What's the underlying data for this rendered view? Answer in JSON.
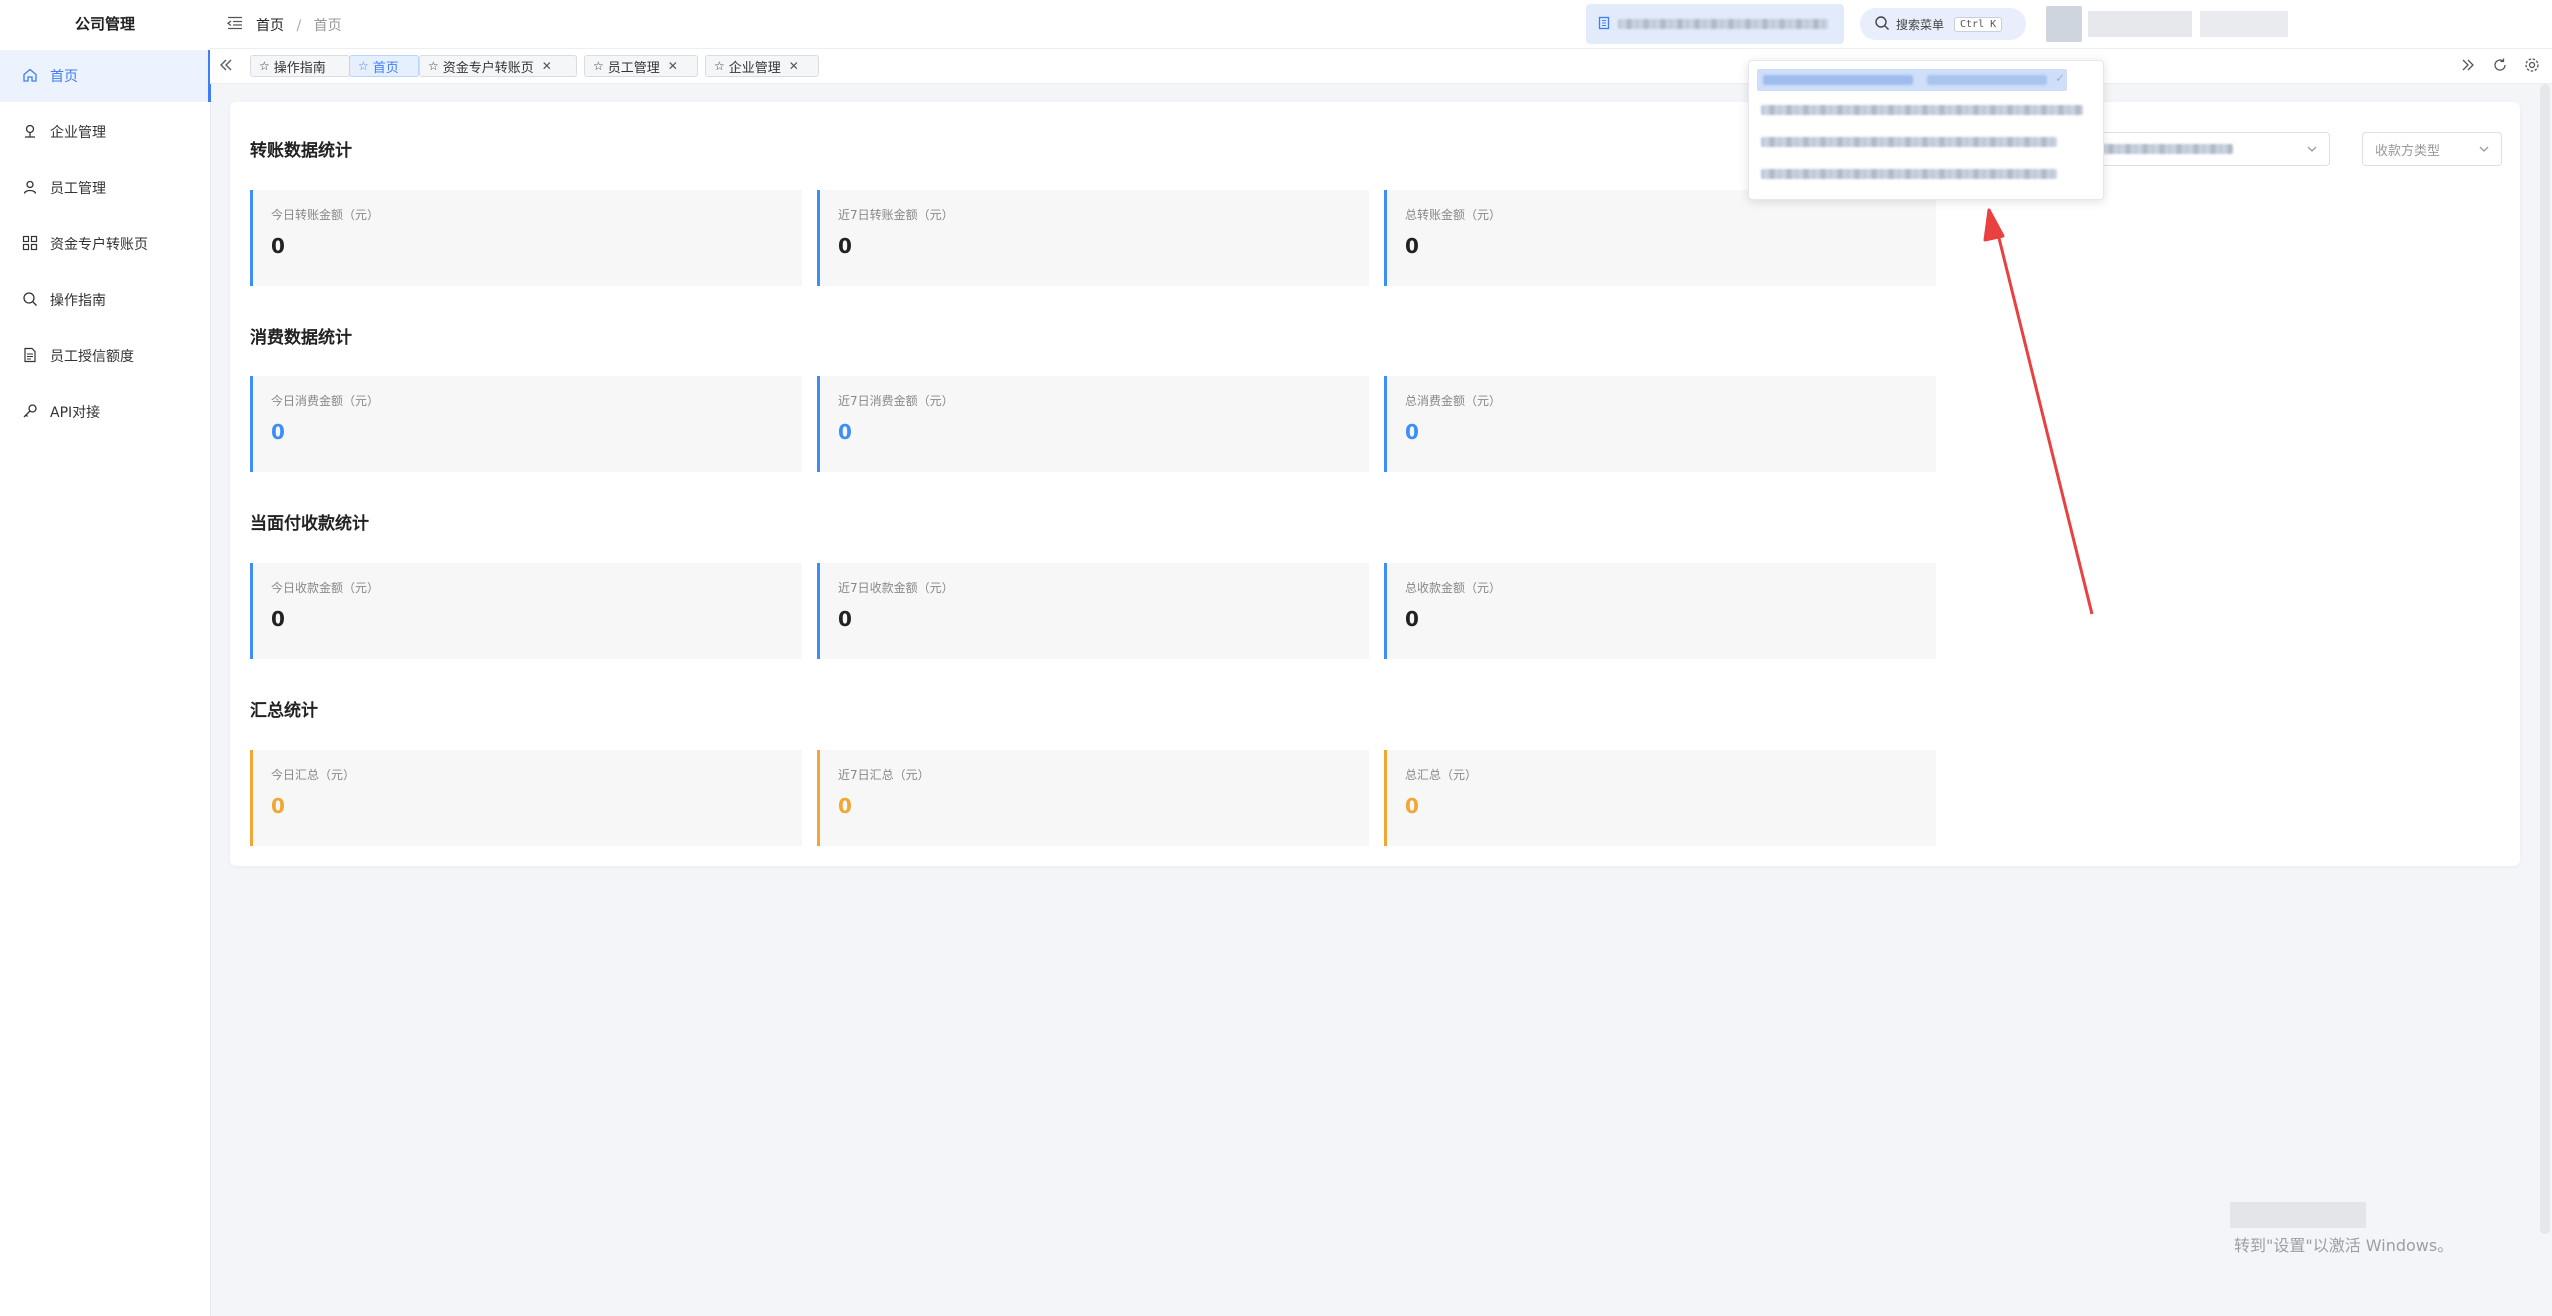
{
  "sidebar": {
    "brand": "公司管理",
    "items": [
      {
        "label": "首页",
        "icon": "home-icon",
        "active": true
      },
      {
        "label": "企业管理",
        "icon": "map-pin-icon"
      },
      {
        "label": "员工管理",
        "icon": "user-icon"
      },
      {
        "label": "资金专户转账页",
        "icon": "grid-icon"
      },
      {
        "label": "操作指南",
        "icon": "search-icon"
      },
      {
        "label": "员工授信额度",
        "icon": "document-icon"
      },
      {
        "label": "API对接",
        "icon": "key-icon"
      }
    ]
  },
  "header": {
    "breadcrumb_home": "首页",
    "breadcrumb_sep": "/",
    "breadcrumb_current": "首页",
    "search_placeholder": "搜索菜单",
    "search_shortcut": "Ctrl K"
  },
  "tabs": [
    {
      "label": "操作指南",
      "closable": false
    },
    {
      "label": "首页",
      "closable": false,
      "active": true
    },
    {
      "label": "资金专户转账页",
      "closable": true
    },
    {
      "label": "员工管理",
      "closable": true
    },
    {
      "label": "企业管理",
      "closable": true
    }
  ],
  "filters": {
    "payment_type_placeholder": "收款方类型"
  },
  "sections": [
    {
      "title": "转账数据统计",
      "color": "#3e8ef7",
      "stats": [
        {
          "label": "今日转账金额（元）",
          "value": "0"
        },
        {
          "label": "近7日转账金额（元）",
          "value": "0"
        },
        {
          "label": "总转账金额（元）",
          "value": "0"
        }
      ]
    },
    {
      "title": "消费数据统计",
      "color": "#3e8ef7",
      "stats": [
        {
          "label": "今日消费金额（元）",
          "value": "0"
        },
        {
          "label": "近7日消费金额（元）",
          "value": "0"
        },
        {
          "label": "总消费金额（元）",
          "value": "0"
        }
      ]
    },
    {
      "title": "当面付收款统计",
      "color": "#3e8ef7",
      "stats": [
        {
          "label": "今日收款金额（元）",
          "value": "0"
        },
        {
          "label": "近7日收款金额（元）",
          "value": "0"
        },
        {
          "label": "总收款金额（元）",
          "value": "0"
        }
      ]
    },
    {
      "title": "汇总统计",
      "color": "#f0a733",
      "stats": [
        {
          "label": "今日汇总（元）",
          "value": "0"
        },
        {
          "label": "近7日汇总（元）",
          "value": "0"
        },
        {
          "label": "总汇总（元）",
          "value": "0"
        }
      ]
    }
  ],
  "watermark": "转到\"设置\"以激活 Windows。",
  "colors": {
    "accent": "#3e7ef6",
    "stat_blue": "#3e8ef7",
    "stat_orange": "#f0a733",
    "annotation_arrow": "#e8413f"
  }
}
